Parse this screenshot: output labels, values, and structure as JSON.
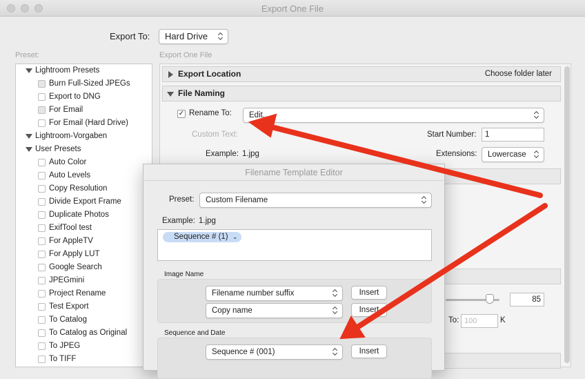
{
  "window": {
    "title": "Export One File"
  },
  "export_to": {
    "label": "Export To:",
    "value": "Hard Drive"
  },
  "preset_panel": {
    "label": "Preset:",
    "folders": [
      {
        "label": "Lightroom Presets"
      },
      {
        "label": "Lightroom-Vorgaben"
      },
      {
        "label": "User Presets"
      }
    ],
    "lightroom_items": [
      "Burn Full-Sized JPEGs",
      "Export to DNG",
      "For Email",
      "For Email (Hard Drive)"
    ],
    "user_items": [
      "Auto Color",
      "Auto Levels",
      "Copy Resolution",
      "Divide Export Frame",
      "Duplicate Photos",
      "ExifTool test",
      "For AppleTV",
      "For Apply LUT",
      "Google Search",
      "JPEGmini",
      "Project Rename",
      "Test Export",
      "To Catalog",
      "To Catalog as Original",
      "To JPEG",
      "To TIFF"
    ]
  },
  "settings": {
    "panel_label": "Export One File",
    "export_location": {
      "title": "Export Location",
      "right_text": "Choose folder later"
    },
    "file_naming": {
      "title": "File Naming",
      "rename_label": "Rename To:",
      "rename_value": "Edit...",
      "custom_text_label": "Custom Text:",
      "start_number_label": "Start Number:",
      "start_number_value": "1",
      "example_label": "Example:",
      "example_value": "1.jpg",
      "extensions_label": "Extensions:",
      "extensions_value": "Lowercase"
    },
    "quality_value": "85",
    "limit_label": "To:",
    "limit_placeholder": "100",
    "limit_unit": "K"
  },
  "dialog": {
    "title": "Filename Template Editor",
    "preset_label": "Preset:",
    "preset_value": "Custom Filename",
    "example_label": "Example:",
    "example_value": "1.jpg",
    "token_label": "Sequence # (1)",
    "image_name": {
      "label": "Image Name",
      "row1_value": "Filename number suffix",
      "row2_value": "Copy name"
    },
    "sequence_and_date": {
      "label": "Sequence and Date",
      "row1_value": "Sequence # (001)"
    },
    "insert_label": "Insert"
  },
  "colors": {
    "annotation_arrow": "#e8321c",
    "token_bg": "#c9dcf6"
  }
}
